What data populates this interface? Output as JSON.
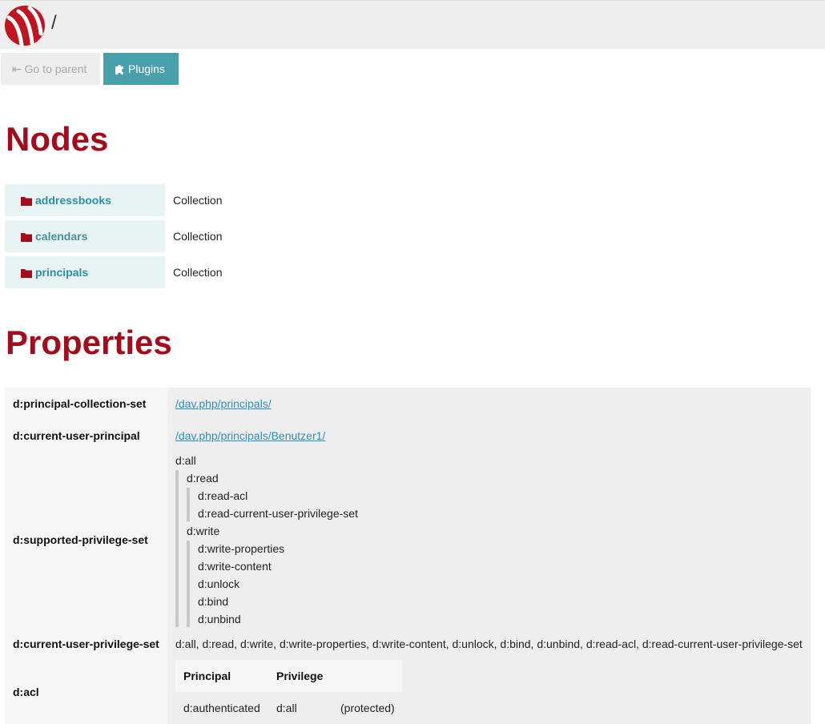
{
  "header": {
    "path": "/"
  },
  "toolbar": {
    "parent_label": "⇤ Go to parent",
    "plugins_label": "Plugins"
  },
  "sections": {
    "nodes_title": "Nodes",
    "properties_title": "Properties"
  },
  "nodes": [
    {
      "name": "addressbooks",
      "type": "Collection"
    },
    {
      "name": "calendars",
      "type": "Collection"
    },
    {
      "name": "principals",
      "type": "Collection"
    }
  ],
  "properties": {
    "principal_collection_set": {
      "name": "d:principal-collection-set",
      "value": "/dav.php/principals/"
    },
    "current_user_principal": {
      "name": "d:current-user-principal",
      "value": "/dav.php/principals/Benutzer1/"
    },
    "supported_privilege_set": {
      "name": "d:supported-privilege-set",
      "root": "d:all",
      "read": "d:read",
      "read_children": [
        "d:read-acl",
        "d:read-current-user-privilege-set"
      ],
      "write": "d:write",
      "write_children": [
        "d:write-properties",
        "d:write-content",
        "d:unlock",
        "d:bind",
        "d:unbind"
      ]
    },
    "current_user_privilege_set": {
      "name": "d:current-user-privilege-set",
      "value": "d:all, d:read, d:write, d:write-properties, d:write-content, d:unlock, d:bind, d:unbind, d:read-acl, d:read-current-user-privilege-set"
    },
    "acl": {
      "name": "d:acl",
      "headers": [
        "Principal",
        "Privilege"
      ],
      "rows": [
        {
          "principal": "d:authenticated",
          "privilege": "d:all",
          "note": "(protected)"
        }
      ]
    }
  },
  "colors": {
    "accent": "#a30c1a",
    "link": "#2b8fa8",
    "plugins_button": "#49a0ad"
  }
}
